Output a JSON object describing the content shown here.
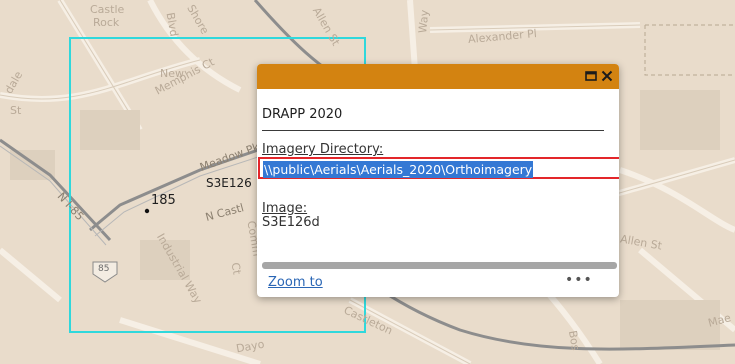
{
  "map": {
    "labels": {
      "castle": "Castle",
      "rock": "Rock",
      "shore": "Shore",
      "blvd": "Blvd",
      "allen": "Allen St",
      "way": "Way",
      "alexander": "Alexander Pl",
      "new": "New",
      "memphis": "Memphis Ct",
      "dale": "dale",
      "st": "St",
      "meadow": "Meadow Pkwy",
      "s3e126_on_map": "S3E126",
      "number_185": "185",
      "castle_cut": "N Castl",
      "comm": "Comm",
      "ct": "Ct",
      "nlis85": "N I-85",
      "industrial": "Industrial Way",
      "route_shield": "85",
      "allen_right": "Allen St",
      "castleton": "Castleton",
      "dayo": "Dayo",
      "bos": "Bos",
      "mae": "Mae"
    },
    "colors": {
      "background": "#e9dccb",
      "selection_outline": "#2fd8dc",
      "road": "#8a8a8a"
    }
  },
  "popup": {
    "title": "DRAPP 2020",
    "header_color": "#d38311",
    "maximize_icon": "maximize-icon",
    "close_icon": "close-icon",
    "fields": {
      "directory_label": "Imagery Directory:",
      "directory_value": "\\\\public\\Aerials\\Aerials_2020\\Orthoimagery",
      "image_label": "Image:",
      "image_value": "S3E126d"
    },
    "actions": {
      "zoom_to": "Zoom to",
      "more": "•••"
    }
  }
}
